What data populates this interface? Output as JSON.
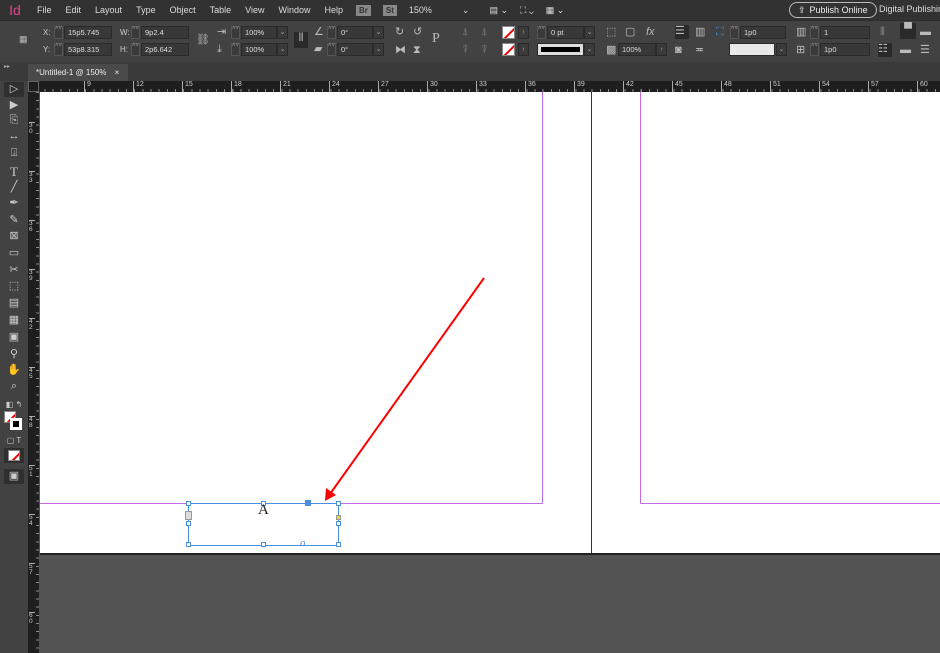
{
  "app": {
    "logo": "Id"
  },
  "menu": [
    "File",
    "Edit",
    "Layout",
    "Type",
    "Object",
    "Table",
    "View",
    "Window",
    "Help"
  ],
  "bridge": "Br",
  "stock": "St",
  "zoom": "150%",
  "publish": "Publish Online",
  "workspace": "Digital Publishing",
  "control": {
    "x_label": "X:",
    "x": "15p5.745",
    "y_label": "Y:",
    "y": "53p8.315",
    "w_label": "W:",
    "w": "9p2.4",
    "h_label": "H:",
    "h": "2p6.642",
    "scale_x": "100%",
    "scale_y": "100%",
    "rotate": "0°",
    "shear": "0°",
    "stroke_weight": "0 pt",
    "opacity": "100%",
    "inset": "1p0",
    "columns": "1",
    "gutter": "1p0"
  },
  "tab": {
    "title": "*Untitled-1 @ 150%",
    "close": "×"
  },
  "hruler": [
    "9",
    "12",
    "15",
    "18",
    "21",
    "24",
    "27",
    "30",
    "33",
    "36",
    "39",
    "42",
    "45",
    "48",
    "51",
    "54",
    "57",
    "60"
  ],
  "vruler": [
    "30",
    "33",
    "36",
    "39",
    "42",
    "45",
    "48",
    "51",
    "54",
    "57",
    "60"
  ],
  "frame": {
    "text": "A",
    "overflow": "o"
  },
  "colors": {
    "margin": "#c26ae8",
    "selection": "#4a8fe0",
    "arrow": "#ff0000"
  }
}
